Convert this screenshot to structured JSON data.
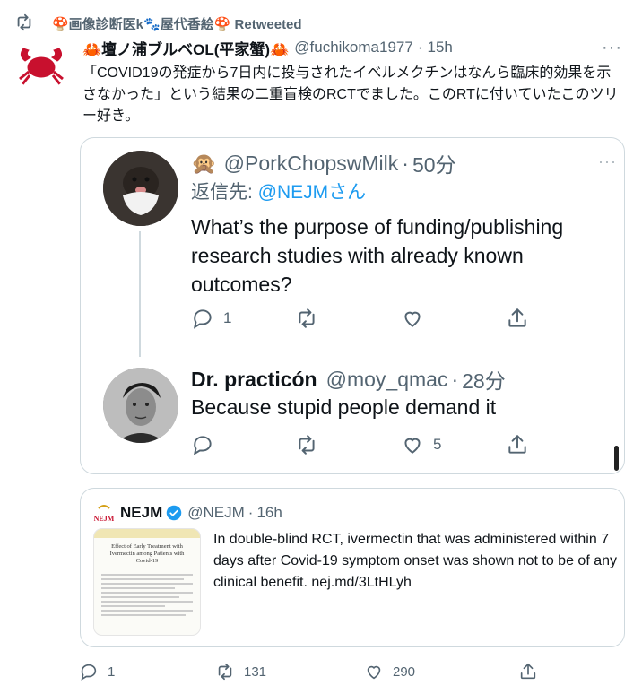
{
  "retweet_bar": {
    "label": "🍄画像診断医k🐾屋代香絵🍄 Retweeted"
  },
  "main_tweet": {
    "name": "🦀壇ノ浦ブルベOL(平家蟹)🦀",
    "handle": "@fuchikoma1977",
    "dot": "·",
    "time": "15h",
    "avatar_text": "MAD CRAB",
    "more": "···",
    "text": "「COVID19の発症から7日内に投与されたイベルメクチンはなんら臨床的効果を示さなかった」という結果の二重盲検のRCTでました。このRTに付いていたこのツリー好き。"
  },
  "thread": {
    "tweet1": {
      "emoji": "🙊",
      "handle": "@PorkChopswMilk",
      "dot": "·",
      "time": "50分",
      "reply_prefix": "返信先: ",
      "reply_mention": "@NEJMさん",
      "text": "What’s the purpose of funding/publishing research studies with already known outcomes?",
      "reply_count": "1",
      "retweet_count": "",
      "like_count": "",
      "more": "···"
    },
    "tweet2": {
      "name": "Dr. practicón",
      "handle": "@moy_qmac",
      "dot": "·",
      "time": "28分",
      "text": "Because stupid people demand it",
      "reply_count": "",
      "retweet_count": "",
      "like_count": "5"
    }
  },
  "quoted": {
    "logo_text": "NEJM",
    "name": "NEJM",
    "handle": "@NEJM",
    "dot": "·",
    "time": "16h",
    "text": "In double-blind RCT, ivermectin that was administered within 7 days after Covid-19 symptom onset was shown not to be of any clinical benefit. nej.md/3LtHLyh",
    "thumb_title": "Effect of Early Treatment with Ivermectin among Patients with Covid-19"
  },
  "footer": {
    "reply_count": "1",
    "retweet_count": "131",
    "like_count": "290"
  },
  "colors": {
    "accent": "#1d9bf0",
    "secondary_text": "#536471",
    "border": "#cfd9de",
    "crab_red": "#c8102e"
  }
}
